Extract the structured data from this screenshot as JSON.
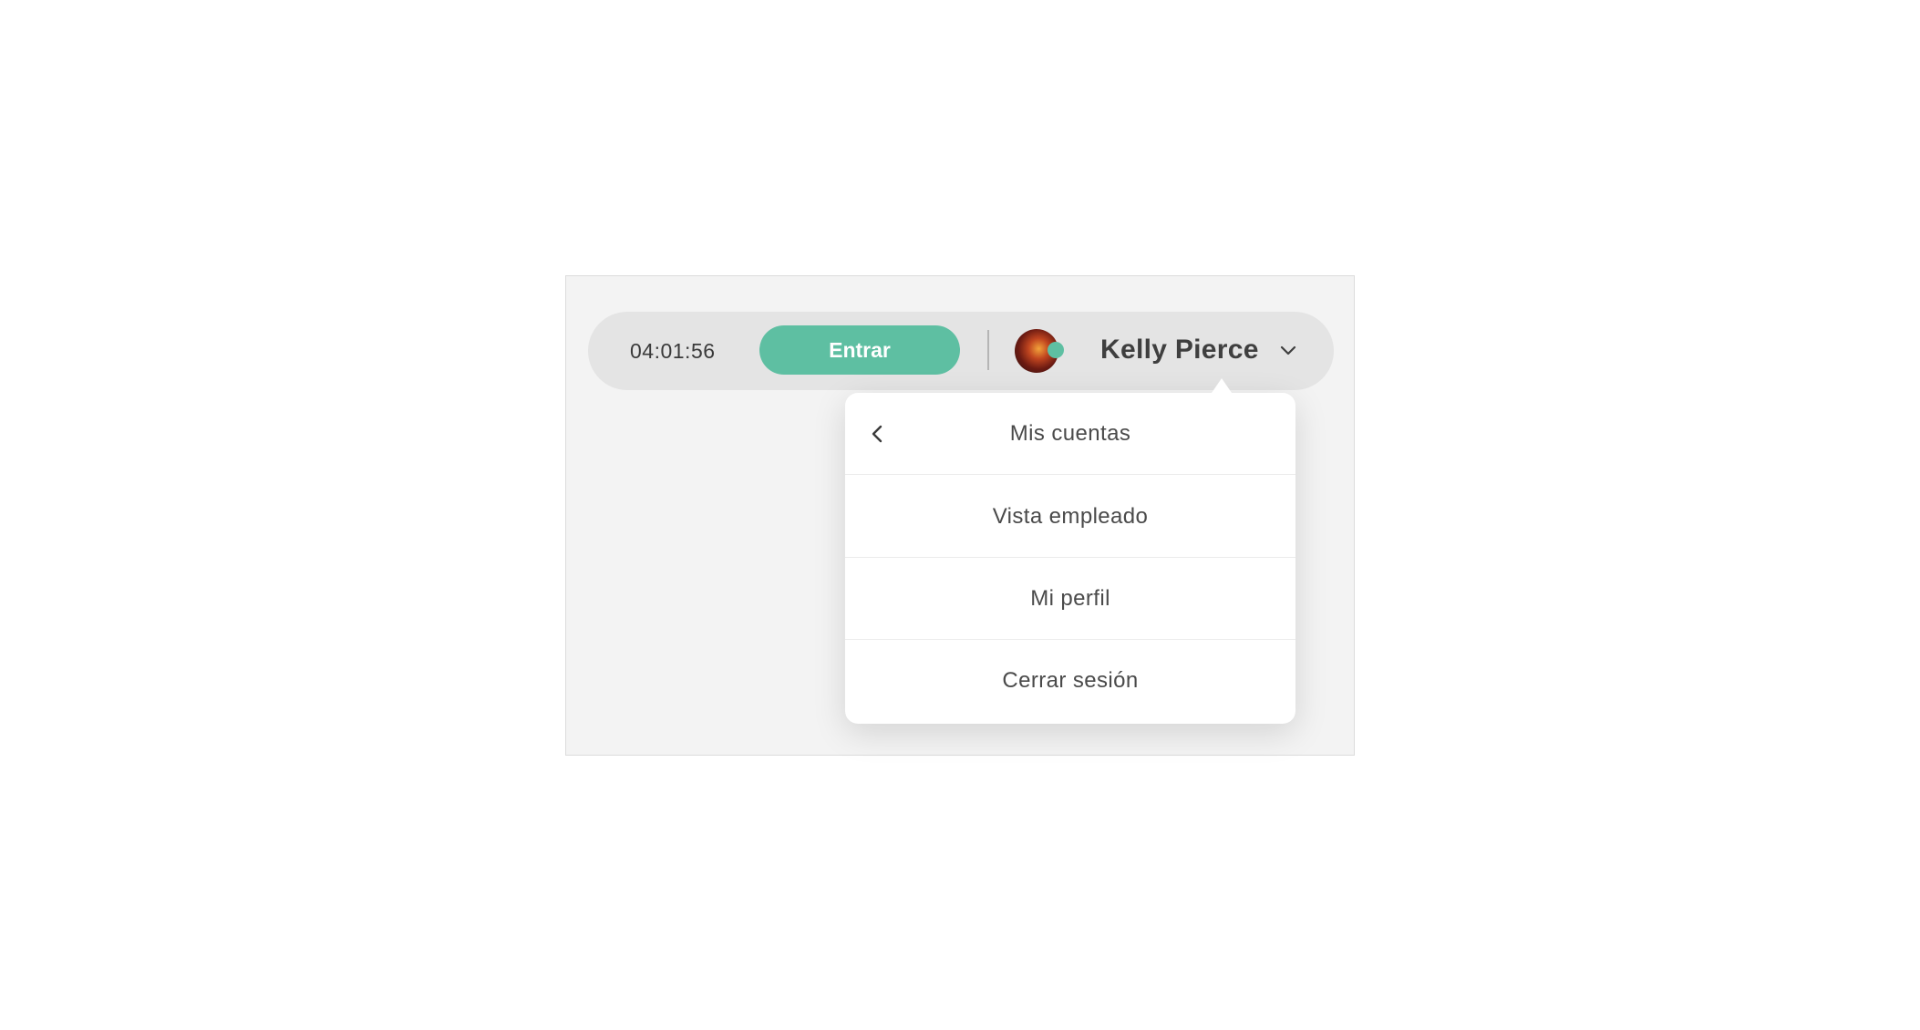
{
  "header": {
    "timer": "04:01:56",
    "clock_in_label": "Entrar",
    "user_name": "Kelly Pierce",
    "avatar_icon": "user-avatar",
    "status_color": "#5ebfa2",
    "chevron_icon": "chevron-down-icon"
  },
  "account_menu": {
    "header_label": "Mis cuentas",
    "back_icon": "chevron-left-icon",
    "items": [
      {
        "label": "Vista empleado"
      },
      {
        "label": "Mi perfil"
      },
      {
        "label": "Cerrar sesión"
      }
    ]
  },
  "colors": {
    "accent": "#5ebfa2",
    "bar_background": "#e4e4e4",
    "stage_background": "#f3f3f3"
  }
}
